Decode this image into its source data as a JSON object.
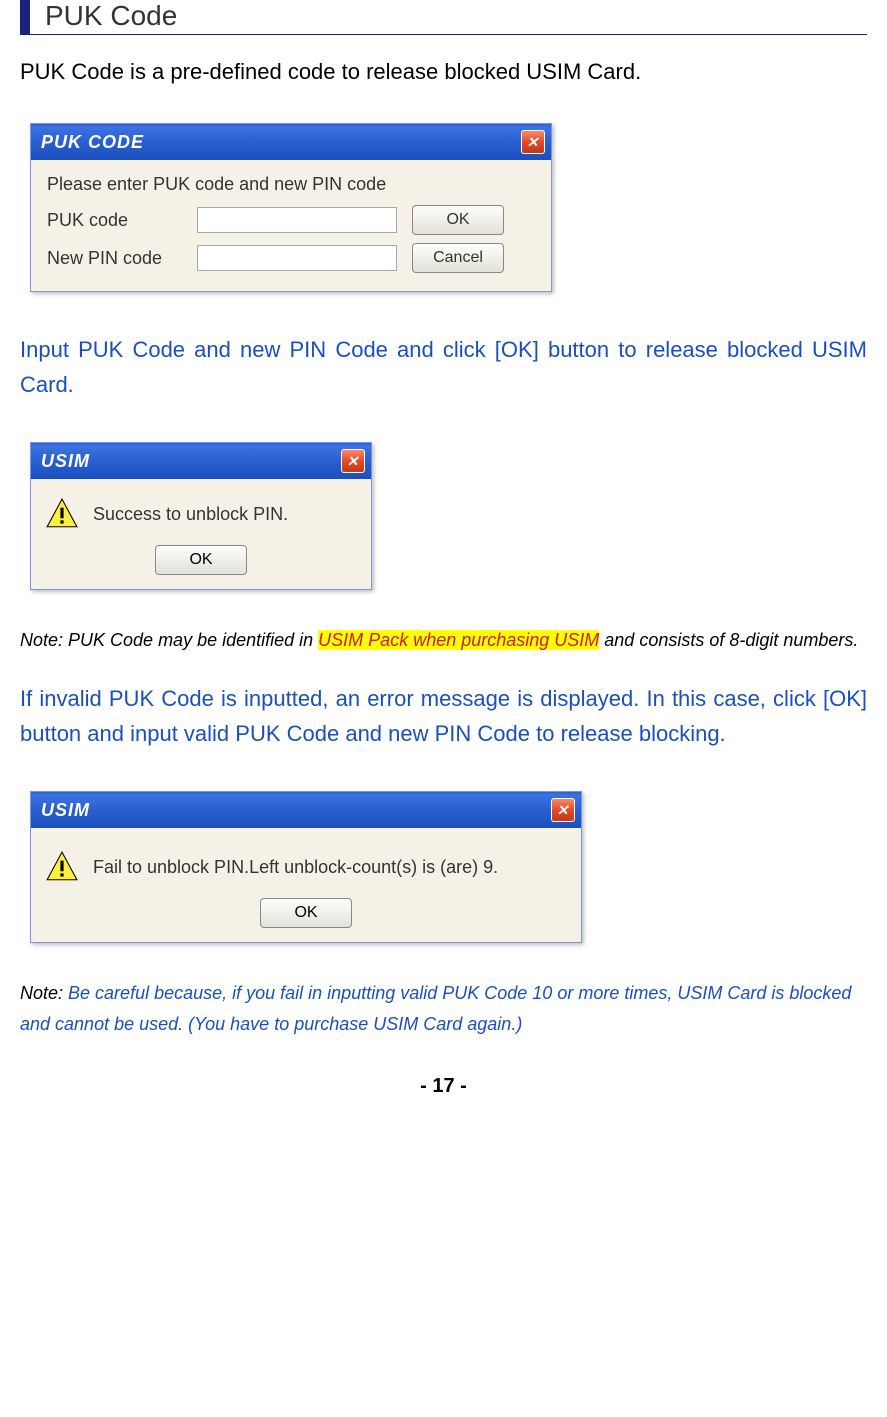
{
  "header": {
    "title": "PUK Code"
  },
  "intro_text": "PUK Code is a pre-defined code to release blocked USIM Card.",
  "puk_dialog": {
    "title": "PUK CODE",
    "instruction": "Please enter PUK code and new PIN code",
    "label_puk": "PUK code",
    "label_pin": "New PIN code",
    "btn_ok": "OK",
    "btn_cancel": "Cancel",
    "close_glyph": "✕"
  },
  "blue_paragraph_1": "Input PUK Code and new PIN Code and click [OK] button to release blocked USIM Card.",
  "usim_success": {
    "title": "USIM",
    "message": "Success to unblock PIN.",
    "btn_ok": "OK",
    "close_glyph": "✕"
  },
  "note1": {
    "prefix": "Note: PUK Code may be identified in ",
    "highlight": "USIM Pack when purchasing USIM",
    "suffix": " and consists of 8-digit numbers."
  },
  "blue_paragraph_2": "If invalid PUK Code is inputted, an error message is displayed. In this case, click [OK] button and input valid PUK Code and new PIN Code to release blocking.",
  "usim_fail": {
    "title": "USIM",
    "message": "Fail to unblock PIN.Left unblock-count(s) is (are) 9.",
    "btn_ok": "OK",
    "close_glyph": "✕"
  },
  "note2": {
    "prefix": "Note: ",
    "body": "Be careful because, if you fail in inputting valid PUK Code 10 or more times, USIM Card is blocked and cannot be used. (You have to purchase USIM Card again.)"
  },
  "page_number": "- 17 -"
}
